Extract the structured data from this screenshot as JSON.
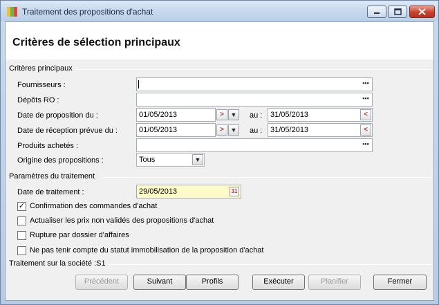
{
  "window": {
    "title": "Traitement des propositions d'achat",
    "icon_colors": [
      "#e6c33b",
      "#6fb24a",
      "#d94b3a"
    ]
  },
  "header": {
    "title": "Critères de sélection principaux"
  },
  "criteres": {
    "group_label": "Critères principaux",
    "fournisseurs_label": "Fournisseurs :",
    "fournisseurs_value": "",
    "depots_label": "Dépôts RO :",
    "depots_value": "",
    "date_proposition_label": "Date de proposition du :",
    "date_proposition_from": "01/05/2013",
    "date_proposition_au": "au :",
    "date_proposition_to": "31/05/2013",
    "date_reception_label": "Date de réception prévue du :",
    "date_reception_from": "01/05/2013",
    "date_reception_au": "au :",
    "date_reception_to": "31/05/2013",
    "produits_label": "Produits achetés :",
    "produits_value": "",
    "origine_label": "Origine des propositions :",
    "origine_value": "Tous"
  },
  "parametres": {
    "group_label": "Paramètres du traitement",
    "date_traitement_label": "Date de traitement :",
    "date_traitement_value": "29/05/2013",
    "options": [
      {
        "label": "Confirmation des commandes d'achat",
        "checked": true
      },
      {
        "label": "Actualiser les prix non validés des propositions d'achat",
        "checked": false
      },
      {
        "label": "Rupture par dossier d'affaires",
        "checked": false
      },
      {
        "label": "Ne pas tenir compte du statut immobilisation de la proposition d'achat",
        "checked": false
      }
    ]
  },
  "societe": {
    "label": "Traitement sur la société :S1"
  },
  "buttons": {
    "precedent": "Précédent",
    "suivant": "Suivant",
    "profils": "Profils",
    "executer": "Exécuter",
    "planifier": "Planifier",
    "fermer": "Fermer"
  },
  "glyphs": {
    "ellipsis": "•••",
    "check": "✓",
    "dropdown": "▼",
    "calendar": "31"
  }
}
